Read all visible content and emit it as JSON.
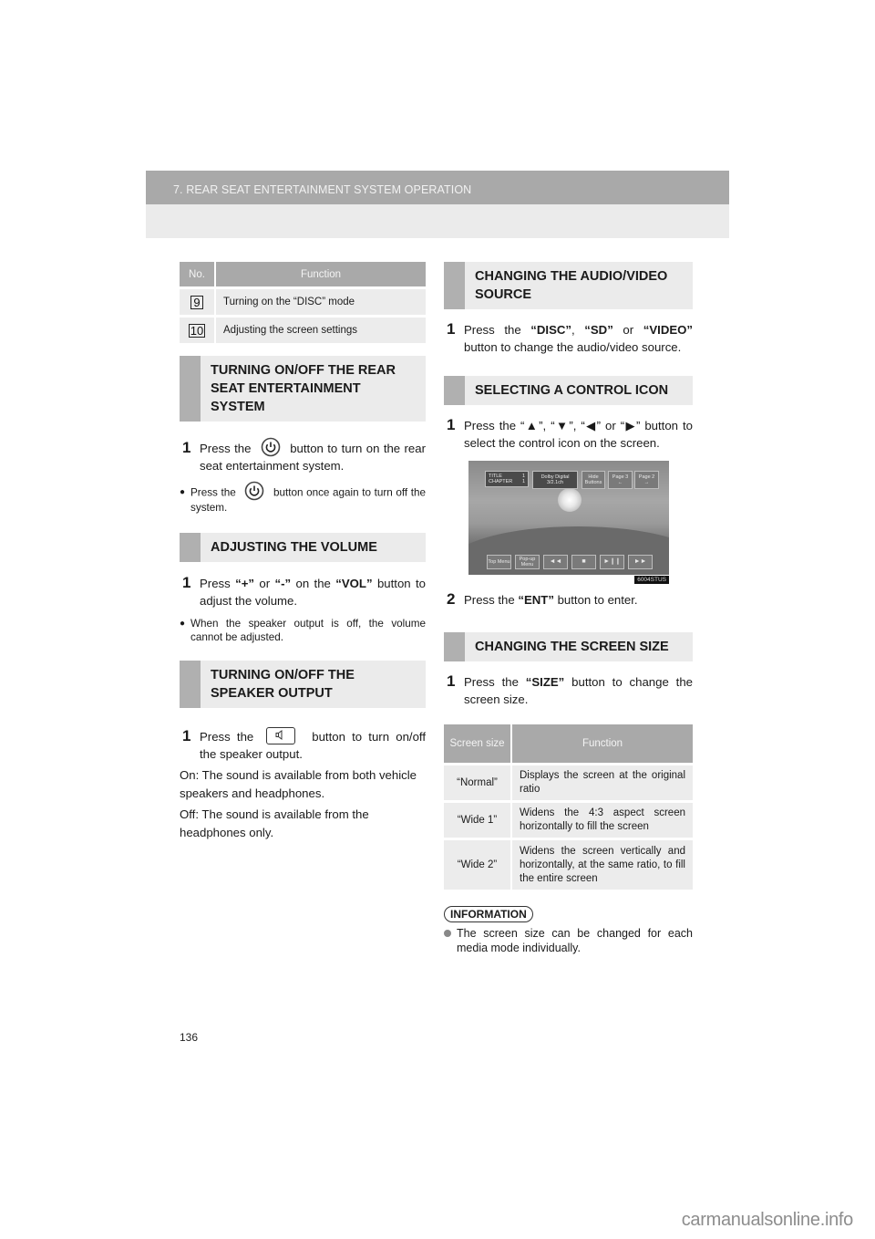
{
  "header": {
    "chapter_title": "7. REAR SEAT ENTERTAINMENT SYSTEM OPERATION"
  },
  "left": {
    "table": {
      "headers": [
        "No.",
        "Function"
      ],
      "rows": [
        {
          "num": "9",
          "function": "Turning on the “DISC” mode"
        },
        {
          "num": "10",
          "function": "Adjusting the screen settings"
        }
      ]
    },
    "sections": [
      {
        "title": "TURNING ON/OFF THE REAR SEAT ENTERTAINMENT SYSTEM",
        "step_num": "1",
        "step_before": "Press the",
        "step_icon": "power-icon",
        "step_after": "button to turn on the rear seat entertainment system.",
        "bullet_before": "Press the",
        "bullet_icon": "power-icon",
        "bullet_after": "button once again to turn off the system."
      },
      {
        "title": "ADJUSTING THE VOLUME",
        "step_num": "1",
        "step_p1": "Press ",
        "step_b1": "“+”",
        "step_p2": " or ",
        "step_b2": "“-”",
        "step_p3": " on the ",
        "step_b3": "“VOL”",
        "step_p4": " button to adjust the volume.",
        "bullet": "When the speaker output is off, the volume cannot be adjusted."
      },
      {
        "title": "TURNING ON/OFF THE SPEAKER OUTPUT",
        "step_num": "1",
        "step_before": "Press the",
        "step_icon": "speaker-icon",
        "step_after": "button to turn on/off the speaker output.",
        "para_on": "On: The sound is available from both vehicle speakers and headphones.",
        "para_off": "Off: The sound is available from the headphones only."
      }
    ]
  },
  "right": {
    "sections": [
      {
        "title": "CHANGING THE AUDIO/VIDEO SOURCE",
        "step_num": "1",
        "p1": "Press the ",
        "b1": "“DISC”",
        "p2": ", ",
        "b2": "“SD”",
        "p3": " or ",
        "b3": "“VIDEO”",
        "p4": " button to change the audio/video source."
      },
      {
        "title": "SELECTING A CONTROL ICON",
        "step1_num": "1",
        "step1_text": "Press the “▲”, “▼”, “◀” or “▶” button to select the control icon on the screen.",
        "screen": {
          "title_label": "TITLE",
          "title_value": "1",
          "chapter_label": "CHAPTER",
          "chapter_value": "1",
          "audio_format_line1": "Dolby Digital",
          "audio_format_line2": "3/2.1ch",
          "hide_buttons": "Hide Buttons",
          "page3": "Page 3",
          "page2": "Page 2",
          "top_menu": "Top Menu",
          "popup_menu": "Pop-up Menu",
          "rewind": "◄◄",
          "stop": "■",
          "play_pause": "►❙❙",
          "fast_forward": "►►",
          "image_code": "6004STUS"
        },
        "step2_num": "2",
        "step2_p1": "Press the ",
        "step2_b1": "“ENT”",
        "step2_p2": " button to enter."
      },
      {
        "title": "CHANGING THE SCREEN SIZE",
        "step_num": "1",
        "p1": "Press the ",
        "b1": "“SIZE”",
        "p2": " button to change the screen size."
      }
    ],
    "size_table": {
      "headers": [
        "Screen size",
        "Function"
      ],
      "rows": [
        {
          "size": "“Normal”",
          "function": "Displays the screen at the original ratio"
        },
        {
          "size": "“Wide 1”",
          "function": "Widens the 4:3 aspect screen horizontally to fill the screen"
        },
        {
          "size": "“Wide 2”",
          "function": "Widens the screen vertically and horizontally, at the same ratio, to fill the entire screen"
        }
      ]
    },
    "information": {
      "label": "INFORMATION",
      "bullet": "The screen size can be changed for each media mode individually."
    }
  },
  "footer": {
    "page_number": "136",
    "watermark": "carmanualsonline.info"
  }
}
